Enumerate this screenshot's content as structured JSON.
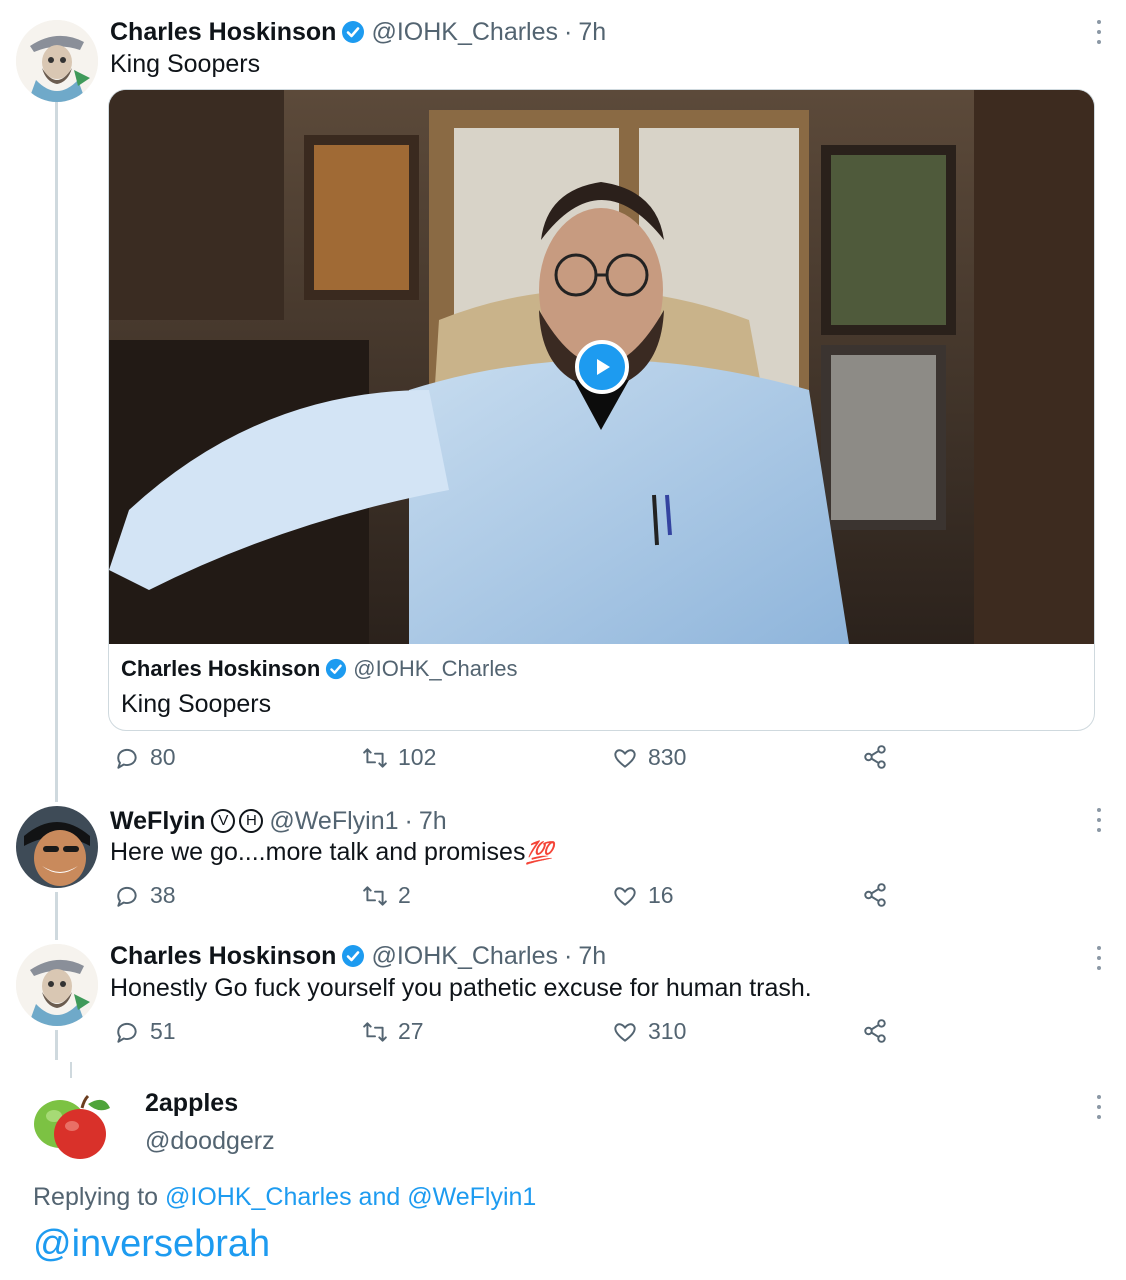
{
  "tweet1": {
    "name": "Charles Hoskinson",
    "handle": "@IOHK_Charles",
    "sep": "·",
    "time": "7h",
    "text": "King Soopers",
    "card": {
      "name": "Charles Hoskinson",
      "handle": "@IOHK_Charles",
      "text": "King Soopers"
    },
    "replies": "80",
    "retweets": "102",
    "likes": "830"
  },
  "tweet2": {
    "name": "WeFlyin",
    "badge1": "V",
    "badge2": "H",
    "handle": "@WeFlyin1",
    "sep": "·",
    "time": "7h",
    "text": "Here we go....more talk and promises",
    "emoji": "💯",
    "replies": "38",
    "retweets": "2",
    "likes": "16"
  },
  "tweet3": {
    "name": "Charles Hoskinson",
    "handle": "@IOHK_Charles",
    "sep": "·",
    "time": "7h",
    "text": "Honestly Go fuck yourself you pathetic excuse for human trash.",
    "replies": "51",
    "retweets": "27",
    "likes": "310"
  },
  "reply": {
    "name": "2apples",
    "handle": "@doodgerz",
    "replying_prefix": "Replying to",
    "replying_user1": "@IOHK_Charles",
    "replying_and": "and",
    "replying_user2": "@WeFlyin1",
    "text": "@inversebrah"
  },
  "colors": {
    "accent": "#1d9bf0",
    "muted": "#536471",
    "text": "#0f1419",
    "line": "#cfd9de"
  }
}
